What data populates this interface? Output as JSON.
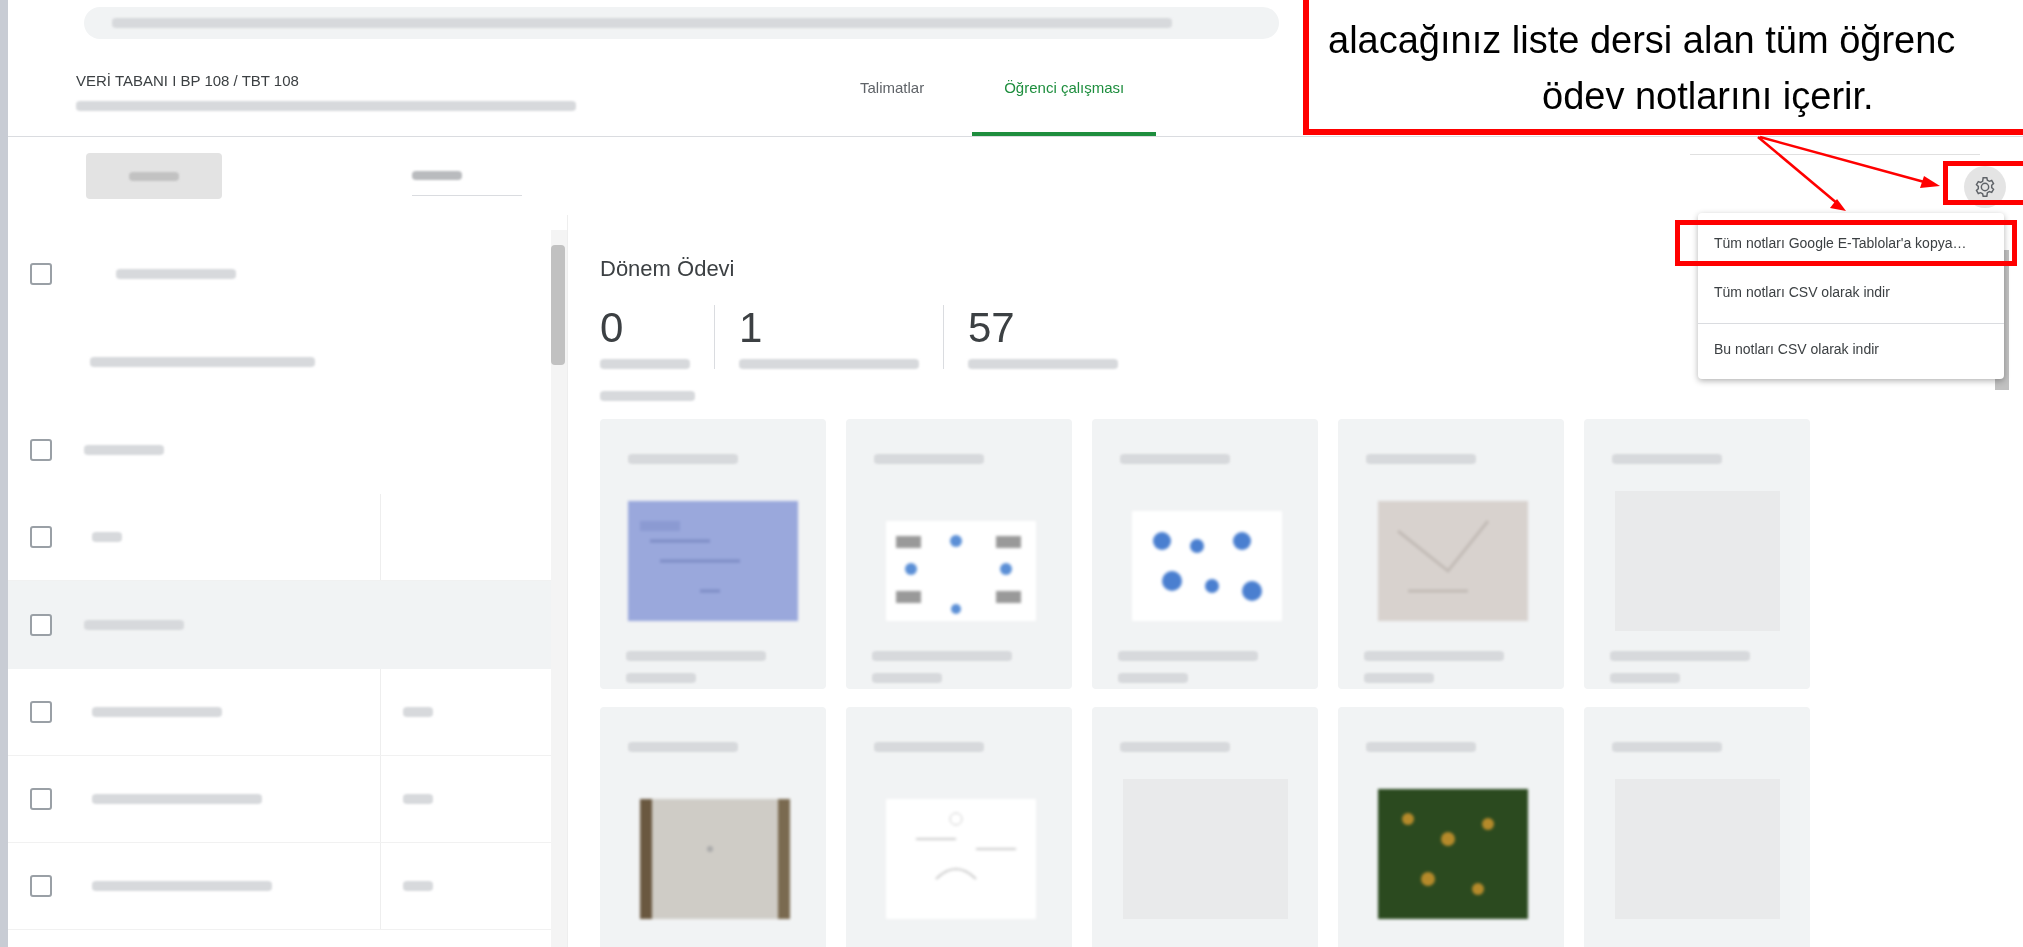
{
  "course": {
    "title": "VERİ TABANI I BP 108 / TBT 108"
  },
  "tabs": [
    {
      "label": "Talimatlar",
      "selected": false
    },
    {
      "label": "Öğrenci çalışması",
      "selected": true
    }
  ],
  "toolbar": {
    "return_disabled": true
  },
  "student_list": [
    {
      "kind": "all",
      "checked": false
    },
    {
      "kind": "sort"
    },
    {
      "kind": "group",
      "checked": false,
      "selected": false
    },
    {
      "kind": "student",
      "checked": false,
      "graded": false
    },
    {
      "kind": "group",
      "checked": false,
      "selected": true
    },
    {
      "kind": "student",
      "checked": false,
      "graded": true
    },
    {
      "kind": "student",
      "checked": false,
      "graded": true
    },
    {
      "kind": "student",
      "checked": false,
      "graded": true
    }
  ],
  "assignment": {
    "title": "Dönem Ödevi",
    "stats": [
      {
        "value": "0"
      },
      {
        "value": "1"
      },
      {
        "value": "57"
      }
    ]
  },
  "submissions": [
    {
      "kind": "blue"
    },
    {
      "kind": "diagram"
    },
    {
      "kind": "dots"
    },
    {
      "kind": "paper"
    },
    {
      "kind": "blank"
    },
    {
      "kind": "wood"
    },
    {
      "kind": "sketch"
    },
    {
      "kind": "blank"
    },
    {
      "kind": "green"
    },
    {
      "kind": "blank"
    }
  ],
  "settings_button": {
    "highlighted": true
  },
  "settings_menu": {
    "items": [
      {
        "label": "Tüm notları Google E-Tablolar'a kopya…",
        "highlighted": true,
        "divider_before": false
      },
      {
        "label": "Tüm notları CSV olarak indir",
        "highlighted": false,
        "divider_before": false
      },
      {
        "label": "Bu notları CSV olarak indir",
        "highlighted": false,
        "divider_before": true
      }
    ]
  },
  "callout": {
    "lines": [
      "alacağınız liste dersi alan tüm öğrenc",
      "ödev notlarını içerir."
    ]
  }
}
